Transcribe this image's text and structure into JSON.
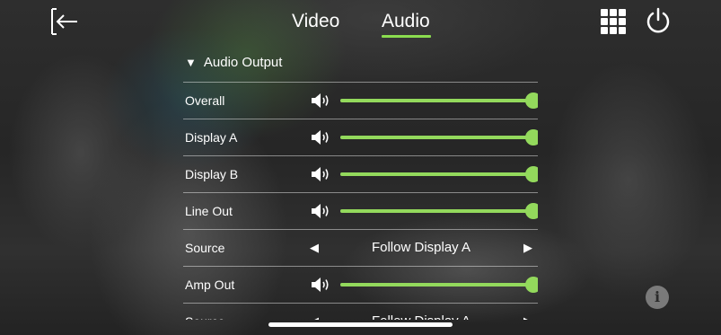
{
  "tabs": [
    {
      "label": "Video",
      "active": false
    },
    {
      "label": "Audio",
      "active": true
    }
  ],
  "colors": {
    "accent": "#93d95c",
    "tab_underline": "#8bdc4f",
    "text": "#ffffff"
  },
  "icons": {
    "back": "exit-arrow-icon",
    "grid": "keypad-grid-icon",
    "power": "power-icon",
    "speaker": "speaker-volume-icon",
    "info": "info-icon"
  },
  "section": {
    "caret": "▼",
    "title": "Audio Output",
    "expanded": true
  },
  "rows": [
    {
      "label": "Overall",
      "type": "volume",
      "level": 1.0
    },
    {
      "label": "Display A",
      "type": "volume",
      "level": 1.0
    },
    {
      "label": "Display B",
      "type": "volume",
      "level": 1.0
    },
    {
      "label": "Line Out",
      "type": "volume",
      "level": 1.0
    },
    {
      "label": "Source",
      "type": "selector",
      "value": "Follow Display A",
      "prev": "◀",
      "next": "▶"
    },
    {
      "label": "Amp Out",
      "type": "volume",
      "level": 1.0
    },
    {
      "label": "Source",
      "type": "selector",
      "value": "Follow Display A",
      "prev": "◀",
      "next": "▶"
    }
  ],
  "info_label": "i"
}
